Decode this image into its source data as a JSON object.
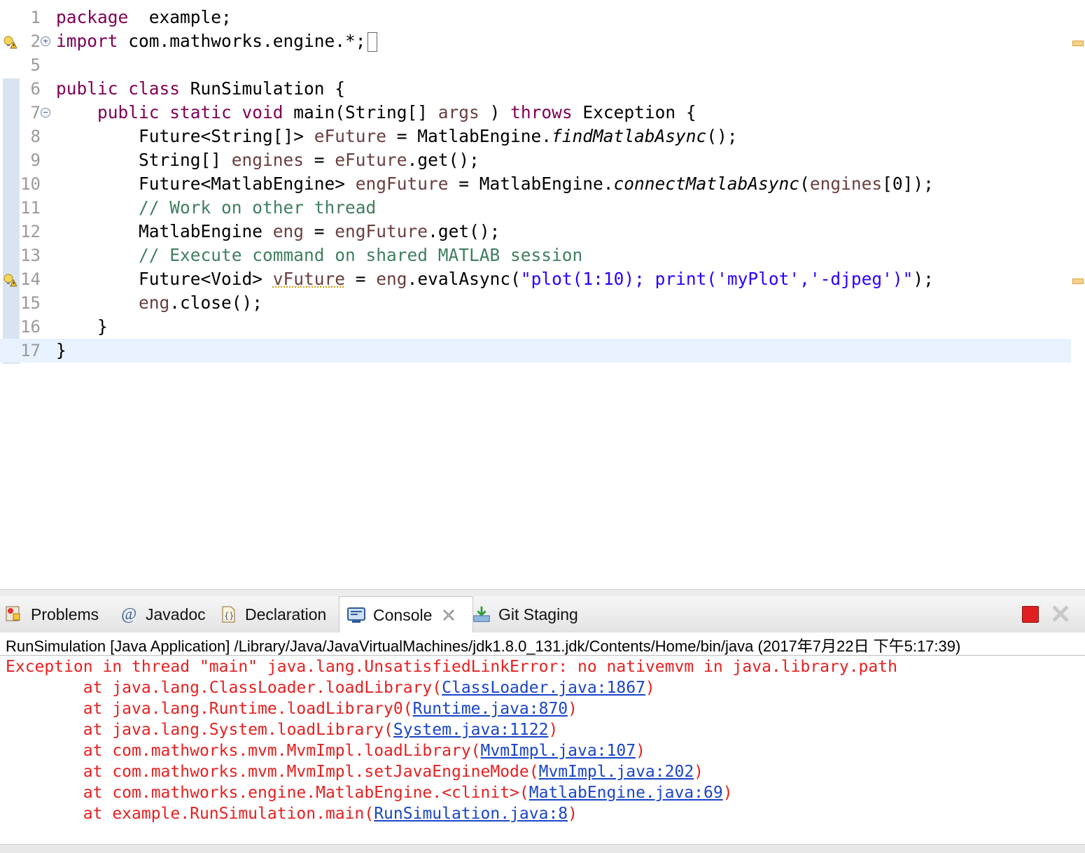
{
  "editor": {
    "lines": [
      {
        "num": "1",
        "parts": [
          [
            "kw",
            "package"
          ],
          [
            "",
            "  example;"
          ]
        ]
      },
      {
        "num": "2",
        "parts": [
          [
            "kw",
            "import"
          ],
          [
            "",
            " com.mathworks.engine.*;"
          ]
        ]
      },
      {
        "num": "5",
        "parts": []
      },
      {
        "num": "6",
        "parts": [
          [
            "kw",
            "public class"
          ],
          [
            "",
            " RunSimulation {"
          ]
        ]
      },
      {
        "num": "7",
        "parts": [
          [
            "",
            "    "
          ],
          [
            "kw",
            "public static void"
          ],
          [
            "",
            " main(String[] "
          ],
          [
            "fld",
            "args"
          ],
          [
            "",
            " ) "
          ],
          [
            "kw",
            "throws"
          ],
          [
            "",
            " Exception {"
          ]
        ]
      },
      {
        "num": "8",
        "parts": [
          [
            "",
            "        Future<String[]> "
          ],
          [
            "fld",
            "eFuture"
          ],
          [
            "",
            " = MatlabEngine."
          ],
          [
            "ital",
            "findMatlabAsync"
          ],
          [
            "",
            "();"
          ]
        ]
      },
      {
        "num": "9",
        "parts": [
          [
            "",
            "        String[] "
          ],
          [
            "fld",
            "engines"
          ],
          [
            "",
            " = "
          ],
          [
            "fld",
            "eFuture"
          ],
          [
            "",
            ".get();"
          ]
        ]
      },
      {
        "num": "10",
        "parts": [
          [
            "",
            "        Future<MatlabEngine> "
          ],
          [
            "fld",
            "engFuture"
          ],
          [
            "",
            " = MatlabEngine."
          ],
          [
            "ital",
            "connectMatlabAsync"
          ],
          [
            "",
            "("
          ],
          [
            "fld",
            "engines"
          ],
          [
            "",
            "[0]);"
          ]
        ]
      },
      {
        "num": "11",
        "parts": [
          [
            "",
            "        "
          ],
          [
            "cmt",
            "// Work on other thread"
          ]
        ]
      },
      {
        "num": "12",
        "parts": [
          [
            "",
            "        MatlabEngine "
          ],
          [
            "fld",
            "eng"
          ],
          [
            "",
            " = "
          ],
          [
            "fld",
            "engFuture"
          ],
          [
            "",
            ".get();"
          ]
        ]
      },
      {
        "num": "13",
        "parts": [
          [
            "",
            "        "
          ],
          [
            "cmt",
            "// Execute command on shared MATLAB session"
          ]
        ]
      },
      {
        "num": "14",
        "parts": [
          [
            "",
            "        Future<Void> "
          ],
          [
            "warn",
            "vFuture"
          ],
          [
            "",
            " = "
          ],
          [
            "fld",
            "eng"
          ],
          [
            "",
            ".evalAsync("
          ],
          [
            "str",
            "\"plot(1:10); print('myPlot','-djpeg')\""
          ],
          [
            "",
            ");"
          ]
        ]
      },
      {
        "num": "15",
        "parts": [
          [
            "",
            "        "
          ],
          [
            "fld",
            "eng"
          ],
          [
            "",
            ".close();"
          ]
        ]
      },
      {
        "num": "16",
        "parts": [
          [
            "",
            "    }"
          ]
        ]
      },
      {
        "num": "17",
        "parts": [
          [
            "",
            "}"
          ]
        ]
      }
    ]
  },
  "tabs": [
    {
      "label": "Problems",
      "icon": "problems-icon"
    },
    {
      "label": "Javadoc",
      "icon": "javadoc-icon"
    },
    {
      "label": "Declaration",
      "icon": "declaration-icon"
    },
    {
      "label": "Console",
      "icon": "console-icon",
      "active": true
    },
    {
      "label": "Git Staging",
      "icon": "git-staging-icon"
    }
  ],
  "console": {
    "header": "RunSimulation [Java Application] /Library/Java/JavaVirtualMachines/jdk1.8.0_131.jdk/Contents/Home/bin/java (2017年7月22日 下午5:17:39)",
    "exception": "Exception in thread \"main\" java.lang.UnsatisfiedLinkError: no nativemvm in java.library.path",
    "trace": [
      {
        "prefix": "        at java.lang.ClassLoader.loadLibrary(",
        "link": "ClassLoader.java:1867",
        "suffix": ")"
      },
      {
        "prefix": "        at java.lang.Runtime.loadLibrary0(",
        "link": "Runtime.java:870",
        "suffix": ")"
      },
      {
        "prefix": "        at java.lang.System.loadLibrary(",
        "link": "System.java:1122",
        "suffix": ")"
      },
      {
        "prefix": "        at com.mathworks.mvm.MvmImpl.loadLibrary(",
        "link": "MvmImpl.java:107",
        "suffix": ")"
      },
      {
        "prefix": "        at com.mathworks.mvm.MvmImpl.setJavaEngineMode(",
        "link": "MvmImpl.java:202",
        "suffix": ")"
      },
      {
        "prefix": "        at com.mathworks.engine.MatlabEngine.<clinit>(",
        "link": "MatlabEngine.java:69",
        "suffix": ")"
      },
      {
        "prefix": "        at example.RunSimulation.main(",
        "link": "RunSimulation.java:8",
        "suffix": ")"
      }
    ]
  },
  "colors": {
    "error": "#e62020",
    "link": "#1a45c8",
    "keyword": "#7f0055",
    "comment": "#3f7f5f",
    "string": "#2a00ff"
  }
}
